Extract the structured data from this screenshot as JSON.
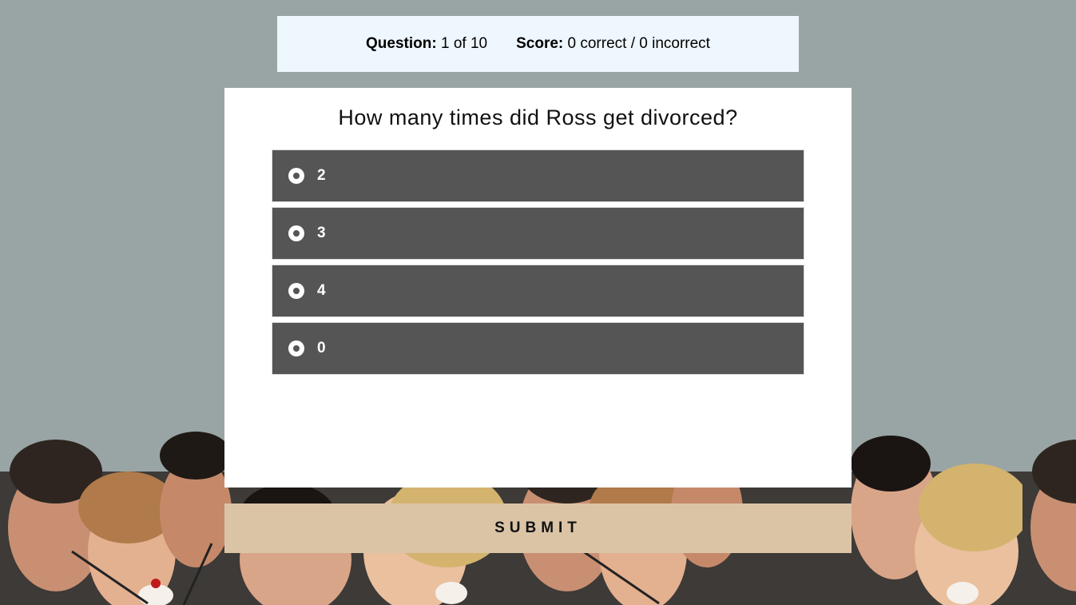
{
  "status": {
    "question_label": "Question:",
    "question_value": "1 of 10",
    "score_label": "Score:",
    "score_value": "0 correct / 0 incorrect"
  },
  "quiz": {
    "question": "How many times did Ross get divorced?",
    "options": [
      {
        "label": "2"
      },
      {
        "label": "3"
      },
      {
        "label": "4"
      },
      {
        "label": "0"
      }
    ]
  },
  "submit": {
    "label": "SUBMIT"
  },
  "colors": {
    "page_background": "#99a5a4",
    "status_background": "#eef6fe",
    "option_background": "#555555",
    "submit_background": "#dbc4a6"
  },
  "background_image": {
    "icon": "friends-cast-photo"
  }
}
